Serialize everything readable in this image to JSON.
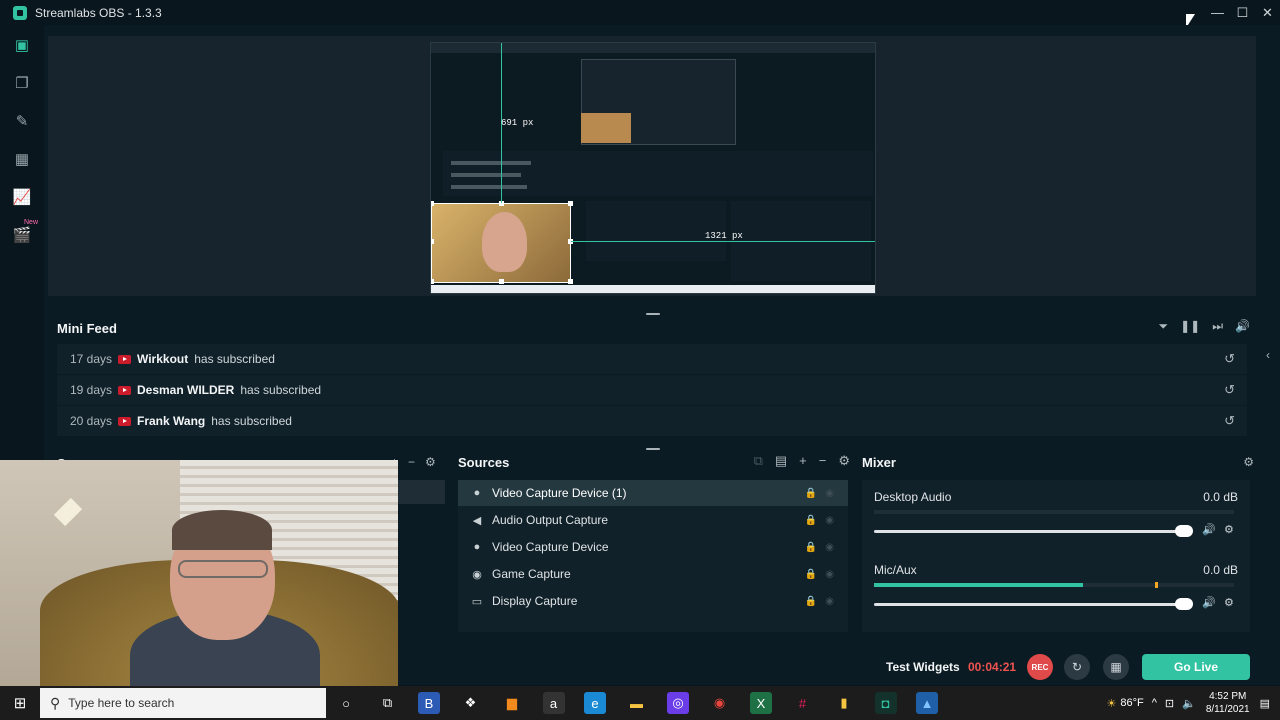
{
  "window": {
    "title": "Streamlabs OBS - 1.3.3",
    "controls": {
      "minimize": "—",
      "maximize": "☐",
      "close": "✕"
    }
  },
  "sidenav": {
    "items": [
      {
        "name": "editor",
        "icon": "▣"
      },
      {
        "name": "layouts",
        "icon": "❐"
      },
      {
        "name": "themes",
        "icon": "✎"
      },
      {
        "name": "store",
        "icon": "▦"
      },
      {
        "name": "dashboard",
        "icon": "📈"
      },
      {
        "name": "highlighter",
        "icon": "🎬"
      }
    ],
    "new_badge": "New"
  },
  "preview": {
    "guide_vertical_label": "691 px",
    "guide_horizontal_label": "1321 px"
  },
  "mini_feed": {
    "title": "Mini Feed",
    "tools": {
      "filter": "⏷",
      "pause": "❚❚",
      "skip": "⏭",
      "volume": "🔊"
    },
    "items": [
      {
        "days": "17 days",
        "user": "Wirkkout",
        "message": "has subscribed"
      },
      {
        "days": "19 days",
        "user": "Desman WILDER",
        "message": "has subscribed"
      },
      {
        "days": "20 days",
        "user": "Frank Wang",
        "message": "has subscribed"
      }
    ],
    "replay_icon": "↺"
  },
  "scenes": {
    "title": "Scenes",
    "tools": {
      "add": "+",
      "remove": "−",
      "settings": "⚙"
    }
  },
  "sources": {
    "title": "Sources",
    "tools": {
      "group": "⧉",
      "folder": "▤",
      "add": "+",
      "remove": "−",
      "settings": "⚙"
    },
    "items": [
      {
        "icon": "●",
        "label": "Video Capture Device (1)",
        "selected": true
      },
      {
        "icon": "◀",
        "label": "Audio Output Capture",
        "selected": false
      },
      {
        "icon": "●",
        "label": "Video Capture Device",
        "selected": false
      },
      {
        "icon": "◉",
        "label": "Game Capture",
        "selected": false
      },
      {
        "icon": "▭",
        "label": "Display Capture",
        "selected": false
      }
    ],
    "flag_icons": {
      "lock": "🔒",
      "eye": "◉"
    }
  },
  "mixer": {
    "title": "Mixer",
    "settings_icon": "⚙",
    "channels": [
      {
        "name": "Desktop Audio",
        "db": "0.0 dB",
        "level": 0.0,
        "peak": 0.0,
        "volume": 1.0
      },
      {
        "name": "Mic/Aux",
        "db": "0.0 dB",
        "level": 0.58,
        "peak": 0.78,
        "volume": 1.0
      }
    ],
    "mute_icon": "🔊",
    "channel_gear": "⚙"
  },
  "footer": {
    "test_widgets": "Test Widgets",
    "timer": "00:04:21",
    "rec": "REC",
    "replay_icon": "↻",
    "schedule_icon": "▦",
    "go_live": "Go Live"
  },
  "taskbar": {
    "search_placeholder": "Type here to search",
    "weather": "86°F",
    "time": "4:52 PM",
    "date": "8/11/2021",
    "apps": [
      {
        "name": "cortana",
        "glyph": "○",
        "color": "#ffffff",
        "bg": "transparent"
      },
      {
        "name": "task-view",
        "glyph": "⧉",
        "color": "#ffffff",
        "bg": "transparent"
      },
      {
        "name": "b-app",
        "glyph": "B",
        "color": "#ffffff",
        "bg": "#2b5bb5"
      },
      {
        "name": "dropbox",
        "glyph": "❖",
        "color": "#ffffff",
        "bg": "transparent"
      },
      {
        "name": "store-bag",
        "glyph": "▆",
        "color": "#f28a1e",
        "bg": "transparent"
      },
      {
        "name": "amazon",
        "glyph": "a",
        "color": "#ffffff",
        "bg": "#333333"
      },
      {
        "name": "edge",
        "glyph": "e",
        "color": "#ffffff",
        "bg": "#1a8ad4"
      },
      {
        "name": "file-explorer",
        "glyph": "▬",
        "color": "#f5c542",
        "bg": "transparent"
      },
      {
        "name": "messenger",
        "glyph": "◎",
        "color": "#ffffff",
        "bg": "#6a3de8"
      },
      {
        "name": "chrome",
        "glyph": "◉",
        "color": "#e8453c",
        "bg": "transparent"
      },
      {
        "name": "excel",
        "glyph": "X",
        "color": "#ffffff",
        "bg": "#1e7145"
      },
      {
        "name": "slack",
        "glyph": "#",
        "color": "#e01e5a",
        "bg": "transparent"
      },
      {
        "name": "folder-app",
        "glyph": "▮",
        "color": "#f5c542",
        "bg": "transparent"
      },
      {
        "name": "streamlabs",
        "glyph": "◘",
        "color": "#31c3a2",
        "bg": "#14322c"
      },
      {
        "name": "photos",
        "glyph": "▲",
        "color": "#7fc4ff",
        "bg": "#1f5fa8"
      }
    ]
  }
}
